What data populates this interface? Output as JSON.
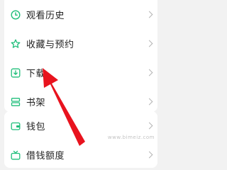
{
  "colors": {
    "accent": "#1fbe7a",
    "arrow": "#e8131e"
  },
  "menu": {
    "items": [
      {
        "label": "观看历史",
        "icon": "clock-icon"
      },
      {
        "label": "收藏与预约",
        "icon": "star-icon"
      },
      {
        "label": "下载",
        "icon": "download-icon"
      },
      {
        "label": "书架",
        "icon": "bookshelf-icon"
      }
    ]
  },
  "finance": {
    "items": [
      {
        "label": "钱包",
        "icon": "wallet-icon"
      },
      {
        "label": "借钱额度",
        "icon": "credit-icon"
      }
    ]
  },
  "watermark": "www.bimeiz.com"
}
